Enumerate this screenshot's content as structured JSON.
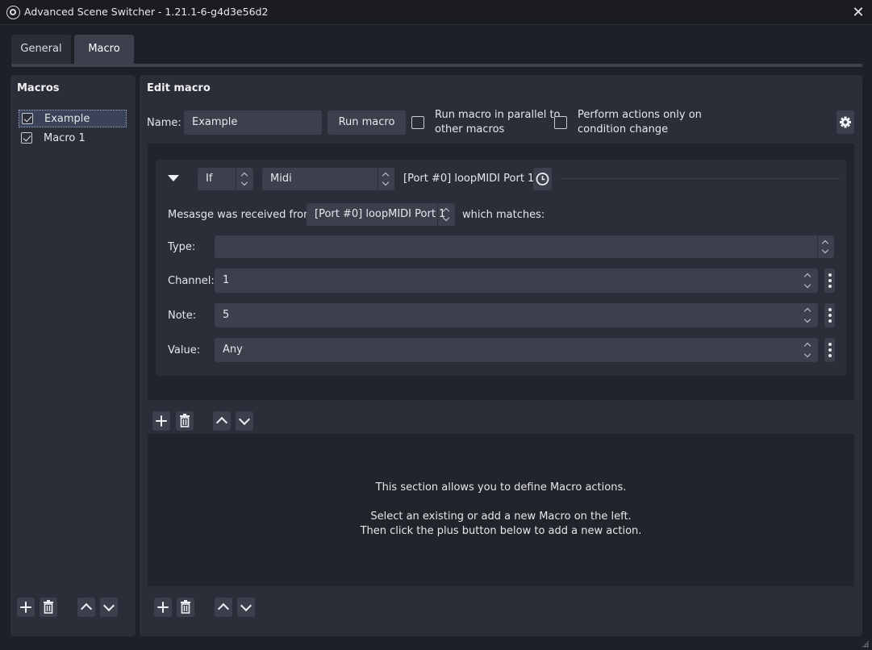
{
  "window": {
    "title": "Advanced Scene Switcher - 1.21.1-6-g4d3e56d2",
    "close_glyph": "✕"
  },
  "tabs": [
    {
      "label": "General",
      "active": false
    },
    {
      "label": "Macro",
      "active": true
    }
  ],
  "macros_panel": {
    "heading": "Macros",
    "items": [
      {
        "label": "Example",
        "checked": true,
        "selected": true
      },
      {
        "label": "Macro 1",
        "checked": true,
        "selected": false
      }
    ]
  },
  "edit_macro": {
    "heading": "Edit macro",
    "name_label": "Name:",
    "name_value": "Example",
    "run_button": "Run macro",
    "parallel_option": {
      "line1": "Run macro in parallel to",
      "line2": "other macros",
      "checked": false
    },
    "condition_change_option": {
      "line1": "Perform actions only on",
      "line2": "condition change",
      "checked": false
    },
    "settings_icon": "gear-icon"
  },
  "condition": {
    "logic": "If",
    "type": "Midi",
    "summary": "[Port #0] loopMIDI Port 1",
    "message_label": "Mesasge was received from",
    "port": "[Port #0] loopMIDI Port 1",
    "matches_label": "which matches:",
    "fields": {
      "type": {
        "label": "Type:",
        "value": ""
      },
      "channel": {
        "label": "Channel:",
        "value": "1"
      },
      "note": {
        "label": "Note:",
        "value": "5"
      },
      "value": {
        "label": "Value:",
        "value": "Any"
      }
    }
  },
  "actions_hint": {
    "line1": "This section allows you to define Macro actions.",
    "line2": "Select an existing or add a new Macro on the left.",
    "line3": "Then click the plus button below to add a new action."
  },
  "colors": {
    "background": "#1e2028",
    "panel": "#2b2e38",
    "control": "#3c404d",
    "area": "#22242b",
    "selection": "#3b4358"
  }
}
